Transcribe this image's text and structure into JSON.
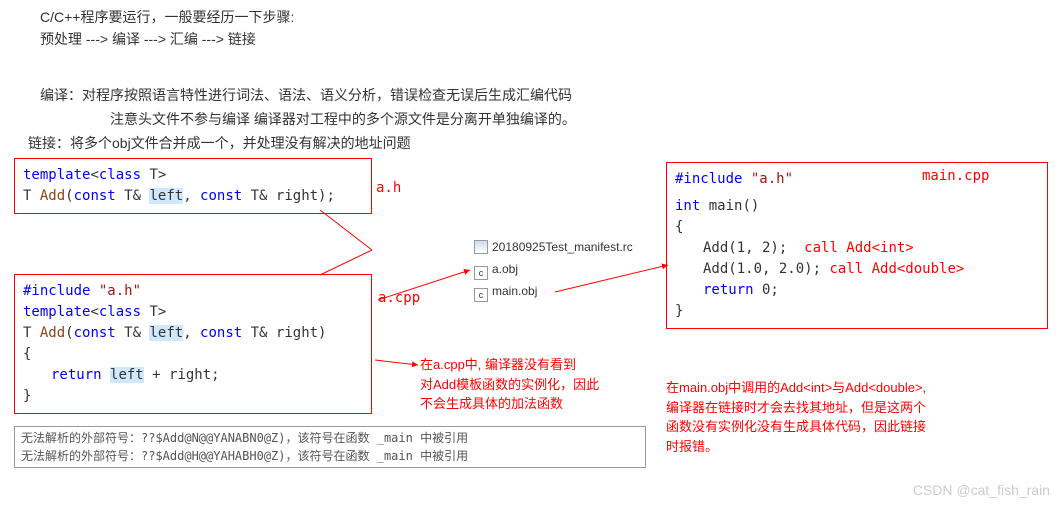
{
  "intro": {
    "l1": "C/C++程序要运行，一般要经历一下步骤:",
    "l2": "预处理 ---> 编译 ---> 汇编 ---> 链接",
    "l3": "编译：对程序按照语言特性进行词法、语法、语义分析，错误检查无误后生成汇编代码",
    "l4": "注意头文件不参与编译  编译器对工程中的多个源文件是分离开单独编译的。",
    "l5": "链接：将多个obj文件合并成一个，并处理没有解决的地址问题"
  },
  "labels": {
    "ah": "a.h",
    "acpp": "a.cpp",
    "maincpp": "main.cpp"
  },
  "ah": {
    "tmpl_kw": "template",
    "lt": "<",
    "class_kw": "class",
    "T": " T",
    "gt": ">",
    "ret": "T ",
    "fn": "Add",
    "lp": "(",
    "const1": "const",
    "amp1": " T& ",
    "p1": "left",
    "comma": ", ",
    "const2": "const",
    "amp2": " T& right)",
    "semi": ";"
  },
  "acpp": {
    "inc": "#include ",
    "hdr": "\"a.h\"",
    "tmpl_kw": "template",
    "lt": "<",
    "class_kw": "class",
    "T": " T",
    "gt": ">",
    "ret": "T ",
    "fn": "Add",
    "lp": "(",
    "const1": "const",
    "amp1": " T& ",
    "p1": "left",
    "comma": ", ",
    "const2": "const",
    "amp2": " T& right)",
    "ob": "{",
    "ret_kw": "return",
    "sp": " ",
    "left": "left",
    "plus": " + right;",
    "cb": "}"
  },
  "main": {
    "inc": "#include ",
    "hdr": "\"a.h\"",
    "int": "int",
    "mainkw": " main",
    "paren": "()",
    "ob": "{",
    "call1": "Add(1, 2);",
    "c1": "call Add<int>",
    "call2": "Add(1.0, 2.0);",
    "c2": "call Add<double>",
    "ret_kw": "return",
    "zero": " 0;",
    "cb": "}"
  },
  "files": {
    "f1": "20180925Test_manifest.rc",
    "f2": "a.obj",
    "f3": "main.obj"
  },
  "note_left": "在a.cpp中, 编译器没有看到\n对Add模板函数的实例化，因此\n不会生成具体的加法函数",
  "note_right": "在main.obj中调用的Add<int>与Add<double>,\n编译器在链接时才会去找其地址，但是这两个\n函数没有实例化没有生成具体代码，因此链接\n时报错。",
  "err1": "无法解析的外部符号：??$Add@N@@YANABN0@Z)，该符号在函数 _main 中被引用",
  "err2": "无法解析的外部符号：??$Add@H@@YAHABH0@Z)，该符号在函数 _main 中被引用",
  "watermark": "CSDN @cat_fish_rain"
}
